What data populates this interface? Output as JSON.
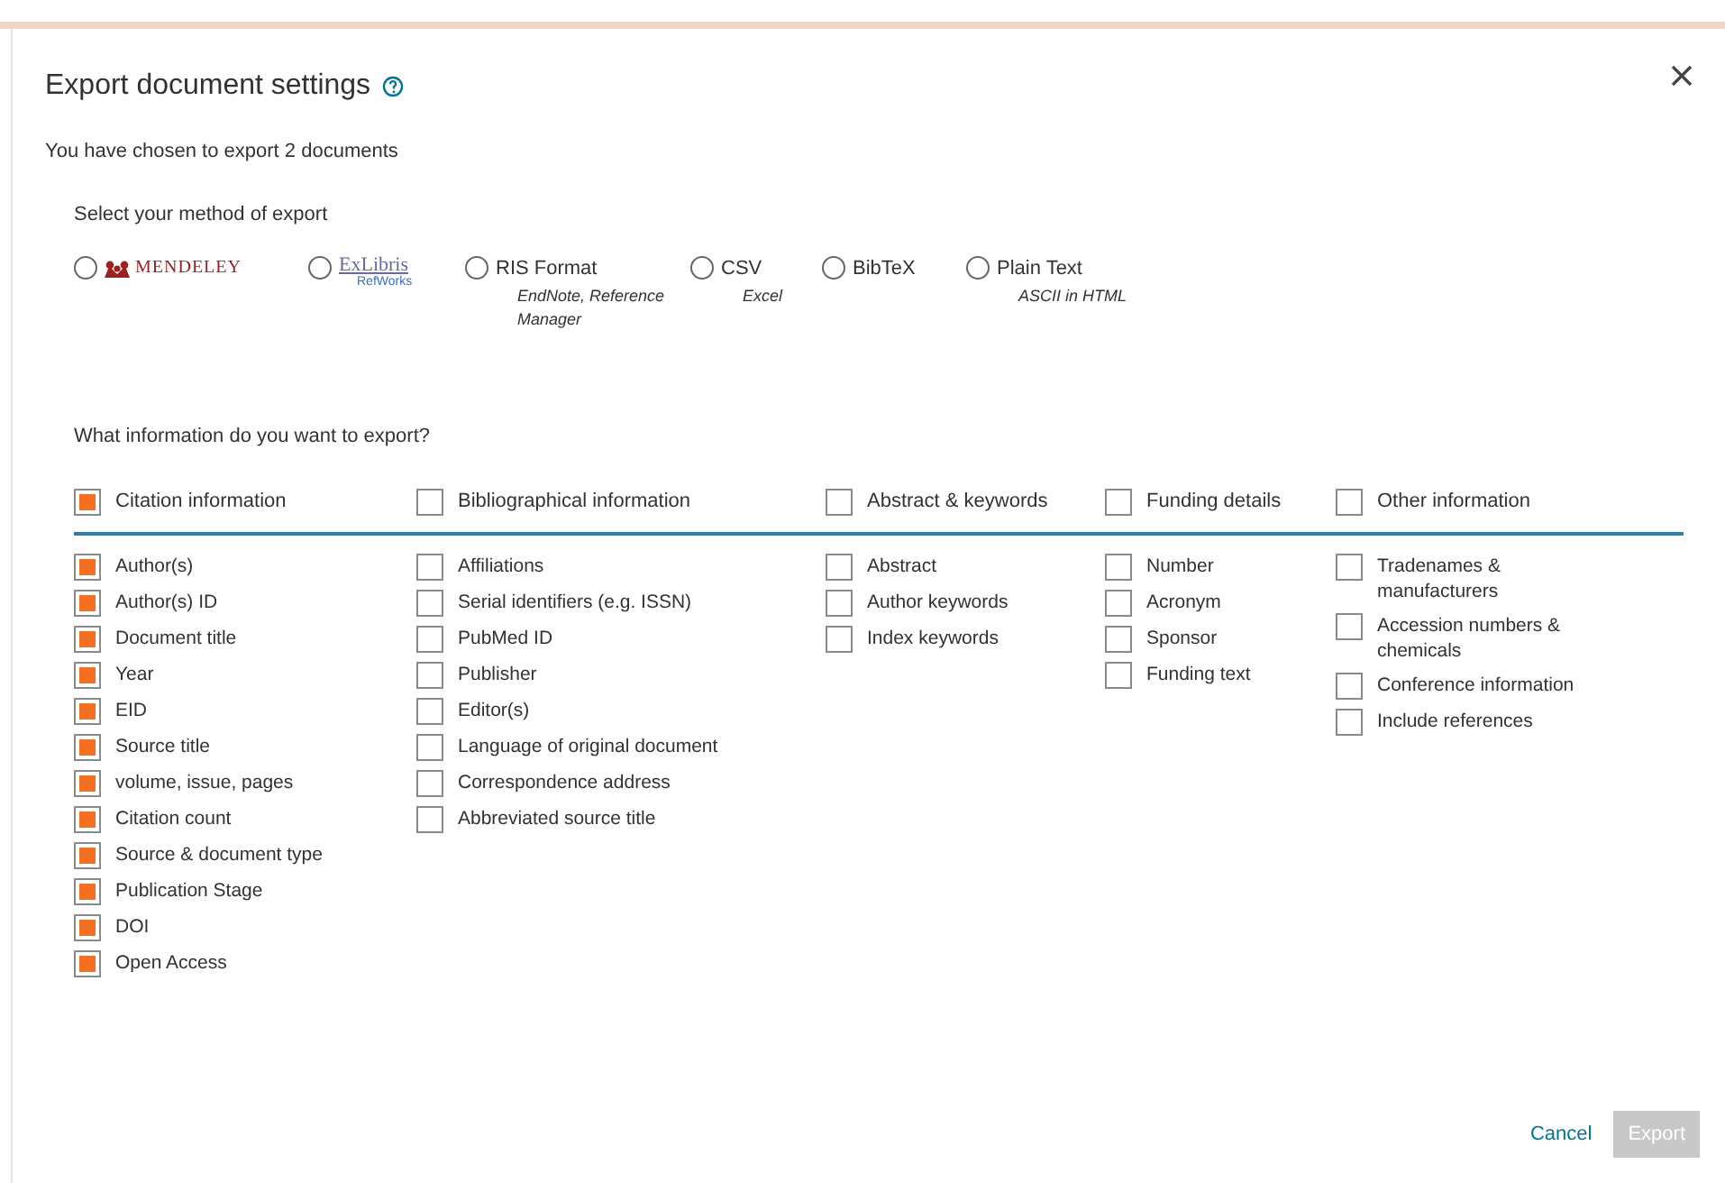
{
  "dialog": {
    "title": "Export document settings",
    "summary": "You have chosen to export 2 documents"
  },
  "method": {
    "label": "Select your method of export",
    "options": [
      {
        "kind": "mendeley",
        "label": "MENDELEY",
        "selected": false
      },
      {
        "kind": "exlibris",
        "label": "ExLibris",
        "sublabel": "RefWorks",
        "selected": false
      },
      {
        "kind": "text",
        "label": "RIS Format",
        "sublabel": "EndNote, Reference Manager",
        "selected": false
      },
      {
        "kind": "text",
        "label": "CSV",
        "sublabel": "Excel",
        "selected": false
      },
      {
        "kind": "text",
        "label": "BibTeX",
        "selected": false
      },
      {
        "kind": "text",
        "label": "Plain Text",
        "sublabel": "ASCII in HTML",
        "selected": false
      }
    ]
  },
  "information": {
    "label": "What information do you want to export?",
    "groups": [
      {
        "label": "Citation information",
        "checked": true,
        "items": [
          {
            "label": "Author(s)",
            "checked": true
          },
          {
            "label": "Author(s) ID",
            "checked": true
          },
          {
            "label": "Document title",
            "checked": true
          },
          {
            "label": "Year",
            "checked": true
          },
          {
            "label": "EID",
            "checked": true
          },
          {
            "label": "Source title",
            "checked": true
          },
          {
            "label": "volume, issue, pages",
            "checked": true
          },
          {
            "label": "Citation count",
            "checked": true
          },
          {
            "label": "Source & document type",
            "checked": true
          },
          {
            "label": "Publication Stage",
            "checked": true
          },
          {
            "label": "DOI",
            "checked": true
          },
          {
            "label": "Open Access",
            "checked": true
          }
        ]
      },
      {
        "label": "Bibliographical information",
        "checked": false,
        "items": [
          {
            "label": "Affiliations",
            "checked": false
          },
          {
            "label": "Serial identifiers (e.g. ISSN)",
            "checked": false
          },
          {
            "label": "PubMed ID",
            "checked": false
          },
          {
            "label": "Publisher",
            "checked": false
          },
          {
            "label": "Editor(s)",
            "checked": false
          },
          {
            "label": "Language of original document",
            "checked": false
          },
          {
            "label": "Correspondence address",
            "checked": false
          },
          {
            "label": "Abbreviated source title",
            "checked": false
          }
        ]
      },
      {
        "label": "Abstract & keywords",
        "checked": false,
        "items": [
          {
            "label": "Abstract",
            "checked": false
          },
          {
            "label": "Author keywords",
            "checked": false
          },
          {
            "label": "Index keywords",
            "checked": false
          }
        ]
      },
      {
        "label": "Funding details",
        "checked": false,
        "items": [
          {
            "label": "Number",
            "checked": false
          },
          {
            "label": "Acronym",
            "checked": false
          },
          {
            "label": "Sponsor",
            "checked": false
          },
          {
            "label": "Funding text",
            "checked": false
          }
        ]
      },
      {
        "label": "Other information",
        "checked": false,
        "items": [
          {
            "label": "Tradenames & manufacturers",
            "checked": false
          },
          {
            "label": "Accession numbers & chemicals",
            "checked": false
          },
          {
            "label": "Conference information",
            "checked": false
          },
          {
            "label": "Include references",
            "checked": false
          }
        ]
      }
    ]
  },
  "buttons": [
    {
      "kind": "link",
      "label": "Cancel",
      "disabled": false
    },
    {
      "kind": "primary",
      "label": "Export",
      "disabled": true
    }
  ]
}
